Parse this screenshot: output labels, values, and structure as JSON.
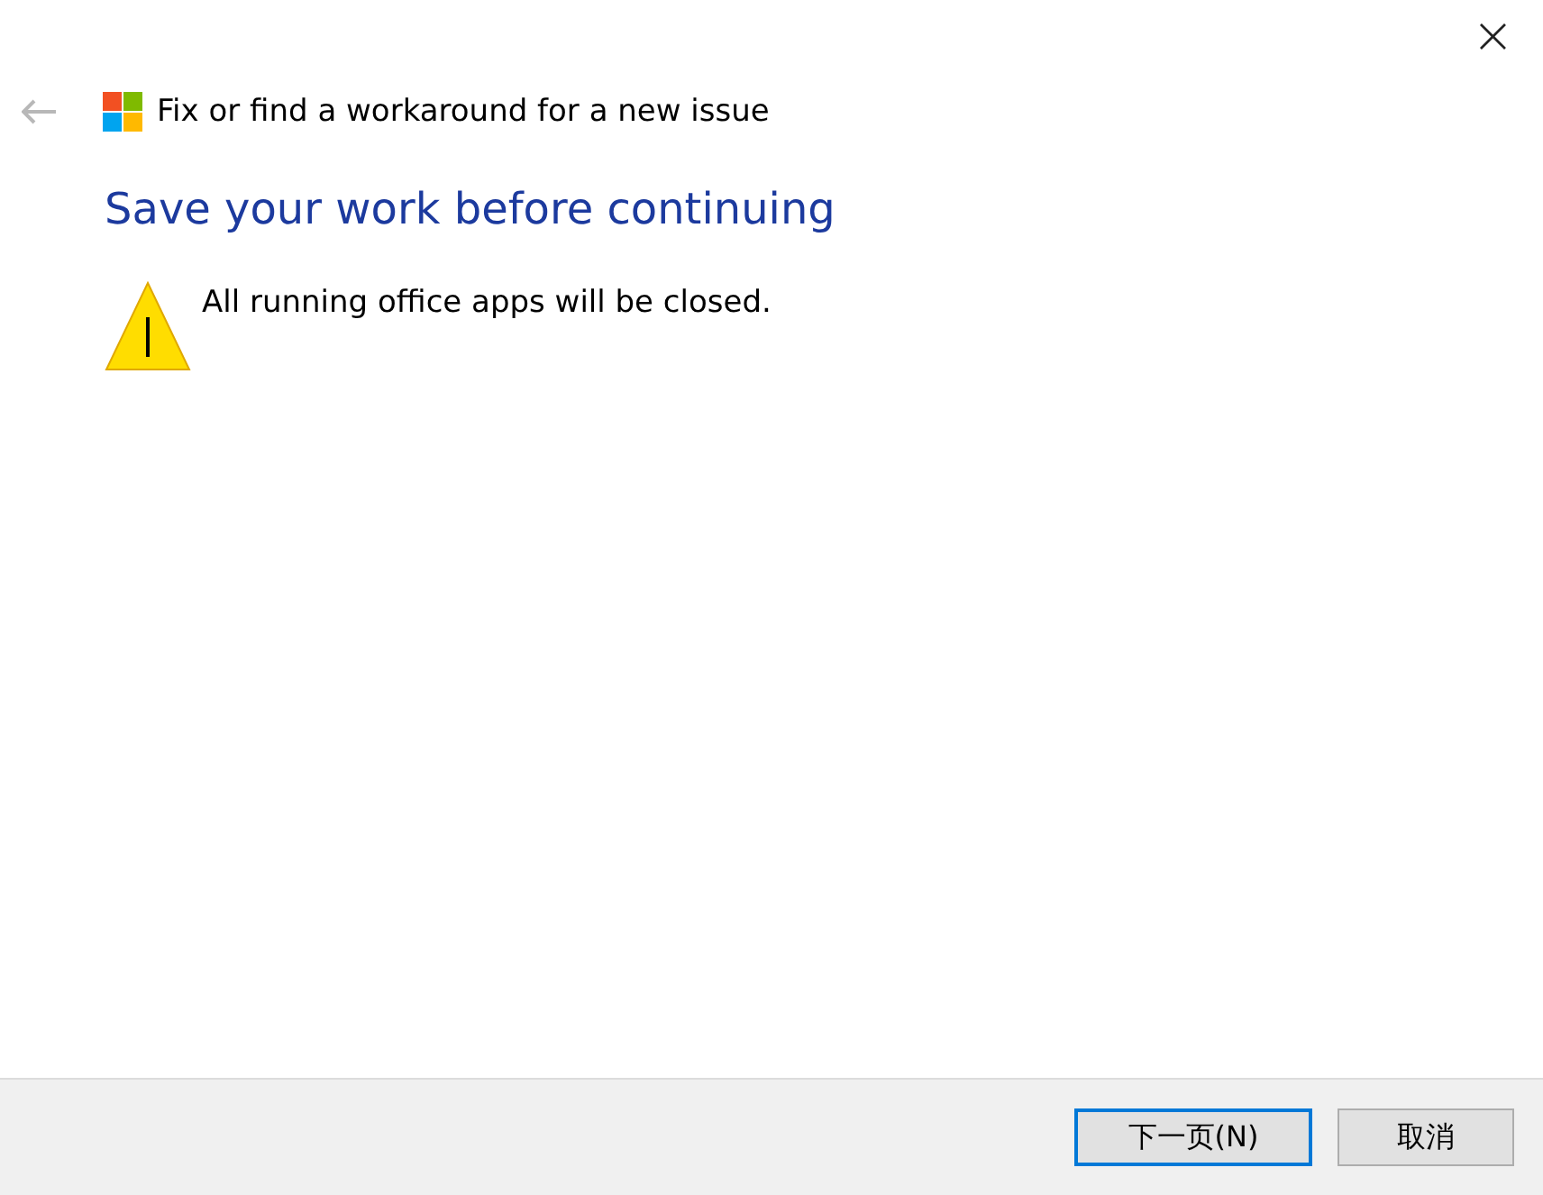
{
  "window": {
    "close": "×"
  },
  "header": {
    "title": "Fix or find a workaround for a new issue"
  },
  "heading": "Save your work before continuing",
  "message": {
    "kind": "warning",
    "text": "All running office apps will be closed."
  },
  "buttons": [
    {
      "label": "下一页(N)",
      "default": true
    },
    {
      "label": "取消",
      "default": false
    }
  ]
}
